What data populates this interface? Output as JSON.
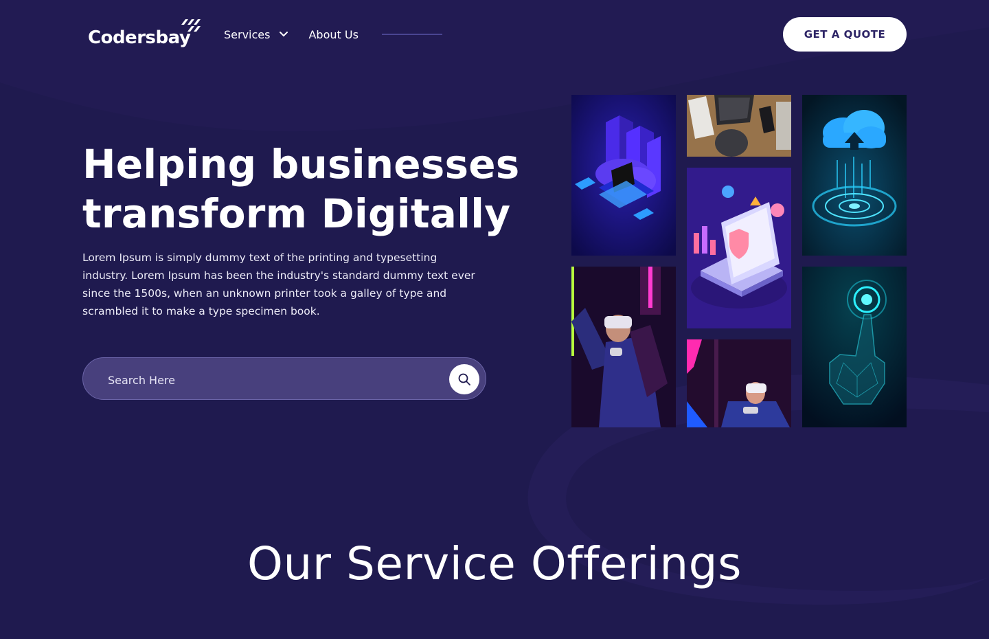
{
  "header": {
    "logo_text": "Codersbay",
    "nav": {
      "services_label": "Services",
      "about_label": "About Us"
    },
    "cta_label": "GET A QUOTE"
  },
  "hero": {
    "title_line1": "Helping businesses",
    "title_line2": "transform Digitally",
    "description": "Lorem Ipsum is simply dummy text of the printing and typesetting industry. Lorem Ipsum has been the industry's standard dummy text ever since the 1500s, when an unknown printer took a galley of type and scrambled it to make a type specimen book.",
    "search_placeholder": "Search Here"
  },
  "gallery": {
    "images": [
      "isometric-cloud-servers-image",
      "laptop-desk-image",
      "cloud-upload-image",
      "isometric-laptop-security-image",
      "vr-gamer-image",
      "vr-player-image",
      "digital-hand-image"
    ]
  },
  "section": {
    "title": "Our Service Offerings"
  },
  "colors": {
    "background": "#1f1a4f",
    "button_text": "#2d2466",
    "search_fill": "#48407d"
  }
}
